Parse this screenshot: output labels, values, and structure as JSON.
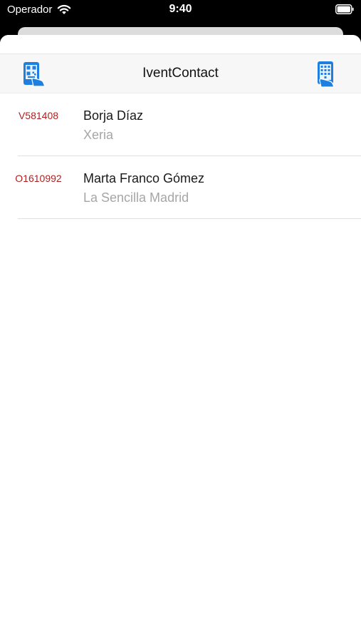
{
  "status_bar": {
    "carrier": "Operador",
    "time": "9:40"
  },
  "nav": {
    "title": "IventContact",
    "left_icon": "qr-scan-icon",
    "right_icon": "keypad-entry-icon",
    "icon_color": "#1e7fe0"
  },
  "contacts": [
    {
      "code": "V581408",
      "name": "Borja Díaz",
      "company": "Xeria"
    },
    {
      "code": "O1610992",
      "name": "Marta Franco Gómez",
      "company": "La Sencilla Madrid"
    }
  ],
  "colors": {
    "code": "#b01f1f",
    "name": "#1a1a1a",
    "company": "#a6a6a6"
  }
}
